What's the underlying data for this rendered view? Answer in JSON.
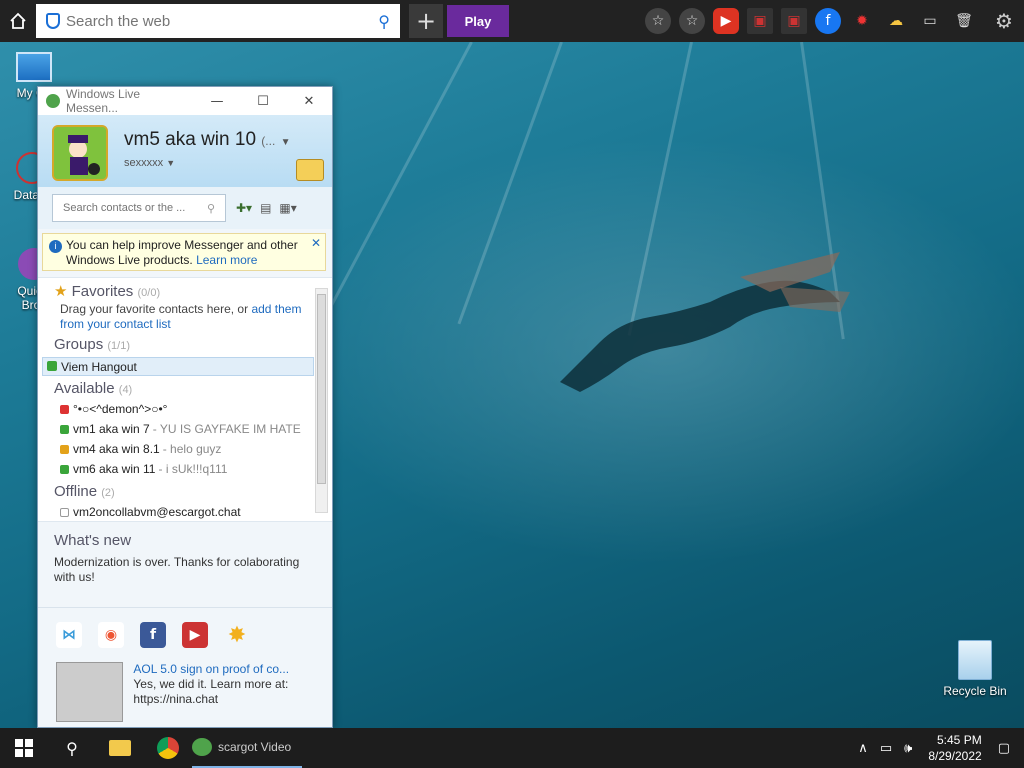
{
  "topbar": {
    "search_placeholder": "Search the web",
    "play_label": "Play"
  },
  "desktop_icons": {
    "my_computer": "My Co",
    "datawin": "DataW",
    "quick_line1": "Quickl",
    "quick_line2": "Brov",
    "recycle_bin": "Recycle Bin"
  },
  "messenger": {
    "window_title": "Windows Live Messen...",
    "display_name": "vm5 aka win 10",
    "name_suffix": "(...",
    "status_text": "sexxxxx",
    "search_placeholder": "Search contacts or the ...",
    "info_text": "You can help improve Messenger and other Windows Live products.",
    "info_link": "Learn more",
    "favorites_label": "Favorites",
    "favorites_count": "(0/0)",
    "favorites_hint": "Drag your favorite contacts here, or",
    "favorites_link": "add them from your contact list",
    "groups_label": "Groups",
    "groups_count": "(1/1)",
    "group_item": "Viem Hangout",
    "available_label": "Available",
    "available_count": "(4)",
    "contacts": [
      {
        "name": "°•○<^demon^>○•°",
        "msg": "",
        "status": "busy"
      },
      {
        "name": "vm1 aka win 7",
        "msg": "- YU IS GAYFAKE IM HATE",
        "status": "online"
      },
      {
        "name": "vm4 aka win 8.1",
        "msg": "- helo guyz",
        "status": "away"
      },
      {
        "name": "vm6 aka win 11",
        "msg": "- i sUk!!!q111",
        "status": "online"
      }
    ],
    "offline_label": "Offline",
    "offline_count": "(2)",
    "offline_contact": "vm2oncollabvm@escargot.chat",
    "news_header": "What's new",
    "news_text": "Modernization is over. Thanks for colaborating with us!",
    "ad_title": "AOL 5.0 sign on proof of co...",
    "ad_body": "Yes, we did it. Learn more at: https://nina.chat"
  },
  "taskbar": {
    "task_label": "scargot Video",
    "time": "5:45 PM",
    "date": "8/29/2022"
  },
  "colors": {
    "topbar": "#222222",
    "play_button": "#6a2a9d",
    "accent_link": "#1f6bbf",
    "taskbar": "#1d1d1d"
  }
}
